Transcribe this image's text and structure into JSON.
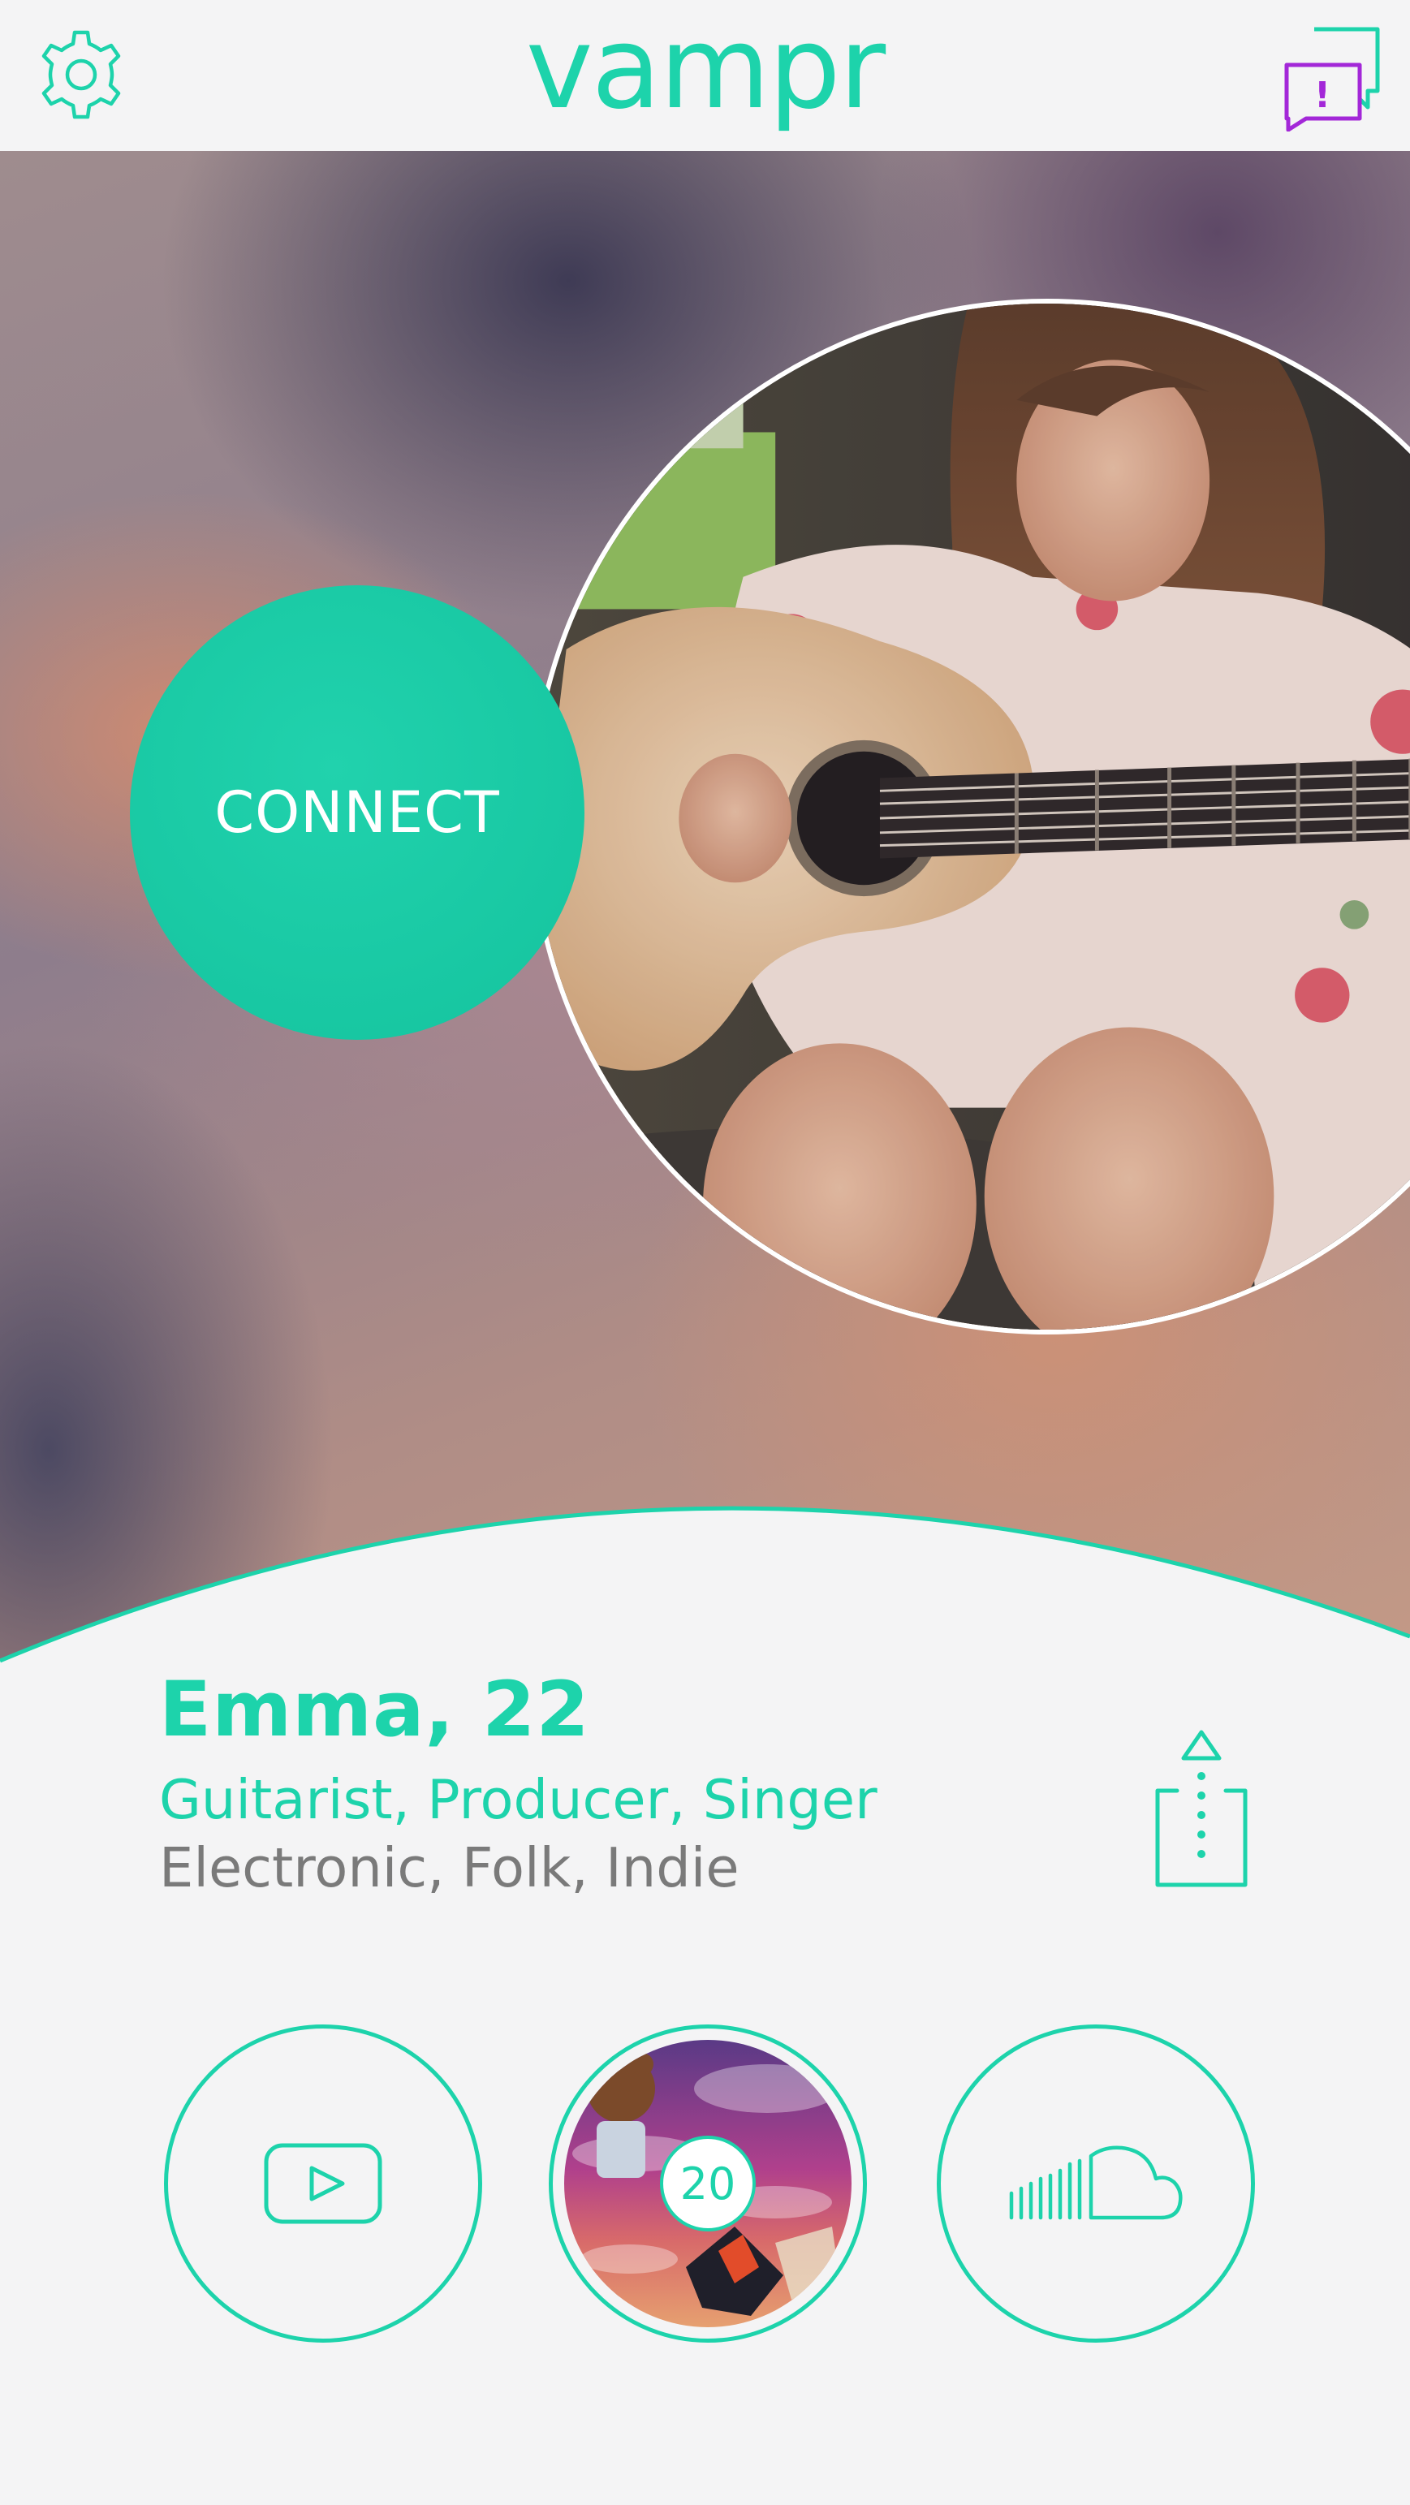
{
  "app": {
    "logo_text": "vampr"
  },
  "header": {
    "settings_icon": "gear-icon",
    "chat_icon": "chat-alert-icon",
    "chat_alert_glyph": "!"
  },
  "hero": {
    "connect_label": "CONNECT",
    "photo": "profile-photo-guitarist"
  },
  "profile": {
    "name_age": "Emma, 22",
    "roles": "Guitarist, Producer, Singer",
    "genres": "Electronic, Folk, Indie"
  },
  "media": {
    "youtube_icon": "youtube-play-icon",
    "album_count": "20",
    "soundcloud_icon": "soundcloud-icon",
    "share_icon": "share-icon"
  },
  "colors": {
    "accent": "#1dd3ab",
    "chat_alert": "#a327d8",
    "background": "#f4f4f5",
    "secondary_text": "#7a7a7a"
  }
}
